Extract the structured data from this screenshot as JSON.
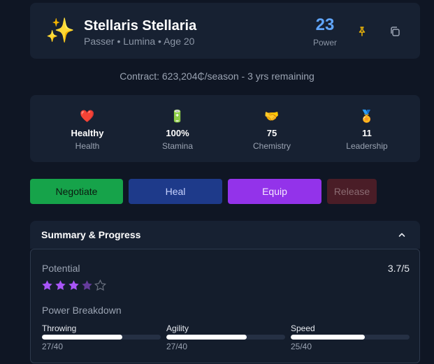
{
  "player": {
    "avatar_icon": "sparkles-emoji",
    "avatar_glyph": "✨",
    "name": "Stellaris Stellaria",
    "subtitle": "Passer • Lumina • Age 20",
    "power_value": "23",
    "power_label": "Power"
  },
  "header_icons": {
    "pin": "pin-icon",
    "copy": "copy-icon"
  },
  "contract": {
    "text": "Contract: 623,204₵/season - 3 yrs remaining"
  },
  "stats": [
    {
      "icon": "heart-icon",
      "glyph": "❤️",
      "value": "Healthy",
      "label": "Health"
    },
    {
      "icon": "battery-icon",
      "glyph": "🔋",
      "value": "100%",
      "label": "Stamina"
    },
    {
      "icon": "handshake-icon",
      "glyph": "🤝",
      "value": "75",
      "label": "Chemistry"
    },
    {
      "icon": "medal-icon",
      "glyph": "🏅",
      "value": "11",
      "label": "Leadership"
    }
  ],
  "actions": {
    "negotiate": "Negotiate",
    "heal": "Heal",
    "equip": "Equip",
    "release": "Release"
  },
  "colors": {
    "negotiate": "#16a34a",
    "heal": "#1e3a8a",
    "equip": "#9333ea",
    "release": "#4a1d27",
    "power": "#60a5fa",
    "star": "#a855f7"
  },
  "summary": {
    "title": "Summary & Progress",
    "potential_label": "Potential",
    "potential_value": "3.7/5",
    "potential_rating": 3.7,
    "stars_max": 5,
    "breakdown_label": "Power Breakdown",
    "breakdown": [
      {
        "name": "Throwing",
        "value": 27,
        "max": 40,
        "text": "27/40"
      },
      {
        "name": "Agility",
        "value": 27,
        "max": 40,
        "text": "27/40"
      },
      {
        "name": "Speed",
        "value": 25,
        "max": 40,
        "text": "25/40"
      }
    ]
  }
}
